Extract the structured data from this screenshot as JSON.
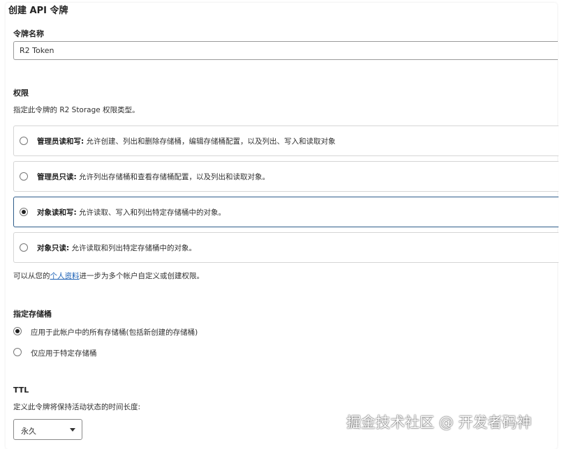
{
  "page": {
    "title": "创建 API 令牌"
  },
  "token_name": {
    "label": "令牌名称",
    "value": "R2 Token"
  },
  "permissions": {
    "heading": "权限",
    "description": "指定此令牌的 R2 Storage 权限类型。",
    "options": [
      {
        "title": "管理员读和写:",
        "desc": "允许创建、列出和删除存储桶，编辑存储桶配置，以及列出、写入和读取对象",
        "selected": false
      },
      {
        "title": "管理员只读:",
        "desc": "允许列出存储桶和查看存储桶配置，以及列出和读取对象。",
        "selected": false
      },
      {
        "title": "对象读和写:",
        "desc": "允许读取、写入和列出特定存储桶中的对象。",
        "selected": true
      },
      {
        "title": "对象只读:",
        "desc": "允许读取和列出特定存储桶中的对象。",
        "selected": false
      }
    ],
    "footer_prefix": "可以从您的",
    "footer_link": "个人资料",
    "footer_suffix": "进一步为多个帐户自定义或创建权限。"
  },
  "buckets": {
    "heading": "指定存储桶",
    "options": [
      {
        "label": "应用于此帐户中的所有存储桶(包括新创建的存储桶)",
        "selected": true
      },
      {
        "label": "仅应用于特定存储桶",
        "selected": false
      }
    ]
  },
  "ttl": {
    "heading": "TTL",
    "description": "定义此令牌将保持活动状态的时间长度:",
    "selected_value": "永久"
  },
  "watermark": "掘金技术社区 @ 开发者码神"
}
